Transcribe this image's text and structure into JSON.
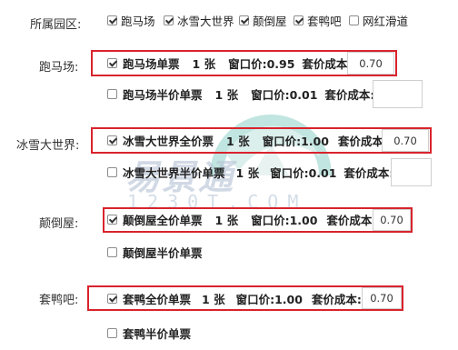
{
  "park_filter": {
    "label": "所属园区:",
    "options": [
      {
        "label": "跑马场",
        "checked": true
      },
      {
        "label": "冰雪大世界",
        "checked": true
      },
      {
        "label": "颠倒屋",
        "checked": true
      },
      {
        "label": "套鸭吧",
        "checked": true
      },
      {
        "label": "网红滑道",
        "checked": false
      }
    ]
  },
  "sections": [
    {
      "label": "跑马场:",
      "rows": [
        {
          "checked": true,
          "name": "跑马场单票",
          "qty": "1 张",
          "window_price": "窗口价:0.95",
          "cost_label": "套价成本:",
          "cost": "0.70",
          "highlighted": true
        },
        {
          "checked": false,
          "name": "跑马场半价单票",
          "qty": "1 张",
          "window_price": "窗口价:0.01",
          "cost_label": "套价成本:",
          "cost": "",
          "highlighted": false
        }
      ]
    },
    {
      "label": "冰雪大世界:",
      "rows": [
        {
          "checked": true,
          "name": "冰雪大世界全价票",
          "qty": "1 张",
          "window_price": "窗口价:1.00",
          "cost_label": "套价成本:",
          "cost": "0.70",
          "highlighted": true
        },
        {
          "checked": false,
          "name": "冰雪大世界半价单票",
          "qty": "1 张",
          "window_price": "窗口价:0.01",
          "cost_label": "套价成本:",
          "cost": "",
          "highlighted": false
        }
      ]
    },
    {
      "label": "颠倒屋:",
      "rows": [
        {
          "checked": true,
          "name": "颠倒屋全价单票",
          "qty": "1 张",
          "window_price": "窗口价:1.00",
          "cost_label": "套价成本:",
          "cost": "0.70",
          "highlighted": true
        },
        {
          "checked": false,
          "name": "颠倒屋半价单票",
          "qty": "",
          "window_price": "",
          "cost_label": "",
          "cost": "",
          "highlighted": false
        }
      ]
    },
    {
      "label": "套鸭吧:",
      "rows": [
        {
          "checked": true,
          "name": "套鸭全价单票",
          "qty": "1 张",
          "window_price": "窗口价:1.00",
          "cost_label": "套价成本:",
          "cost": "0.70",
          "highlighted": true
        },
        {
          "checked": false,
          "name": "套鸭半价单票",
          "qty": "",
          "window_price": "",
          "cost_label": "",
          "cost": "",
          "highlighted": false
        }
      ]
    }
  ],
  "watermark": {
    "brand": "易景通",
    "domain": "1230T.COM"
  },
  "colors": {
    "highlight": "#d9232d",
    "input_border": "#cfcfcf"
  }
}
